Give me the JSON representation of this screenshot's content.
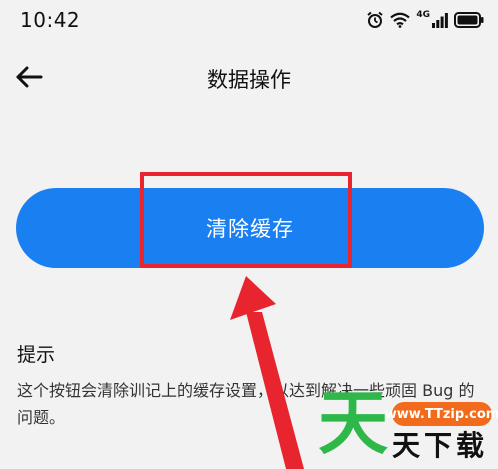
{
  "status_bar": {
    "time": "10:42",
    "network_label": "4G",
    "icons": [
      "alarm-icon",
      "wifi-icon",
      "signal-icon",
      "battery-icon"
    ]
  },
  "header": {
    "back_icon": "arrow-left-icon",
    "title": "数据操作"
  },
  "main": {
    "clear_cache_label": "清除缓存"
  },
  "tip": {
    "heading": "提示",
    "text": "这个按钮会清除训记上的缓存设置，以达到解决一些顽固 Bug 的问题。"
  },
  "annotation": {
    "highlight_color": "#e8242e",
    "arrow_color": "#e8242e"
  },
  "watermark": {
    "big_char": "天",
    "site": "www.TTzip.com",
    "text": "天下载"
  },
  "colors": {
    "primary": "#1a7ff0",
    "background": "#f2f2f2"
  }
}
